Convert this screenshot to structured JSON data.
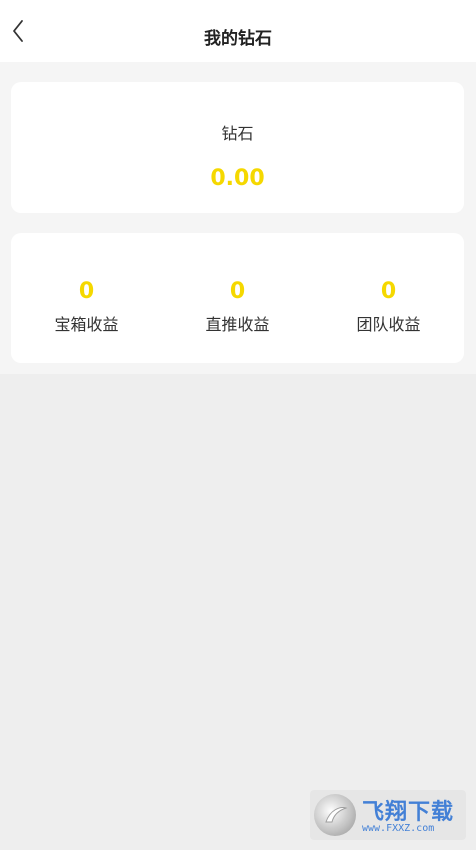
{
  "header": {
    "title": "我的钻石",
    "back_icon": "chevron-left-icon"
  },
  "diamond": {
    "label": "钻石",
    "value": "0.00"
  },
  "earnings": [
    {
      "value": "0",
      "label": "宝箱收益"
    },
    {
      "value": "0",
      "label": "直推收益"
    },
    {
      "value": "0",
      "label": "团队收益"
    }
  ],
  "colors": {
    "accent": "#f5d800",
    "text_dark": "#222222",
    "background": "#eeeeee"
  },
  "watermark": {
    "text": "飞翔下载",
    "url": "www.FXXZ.com"
  }
}
